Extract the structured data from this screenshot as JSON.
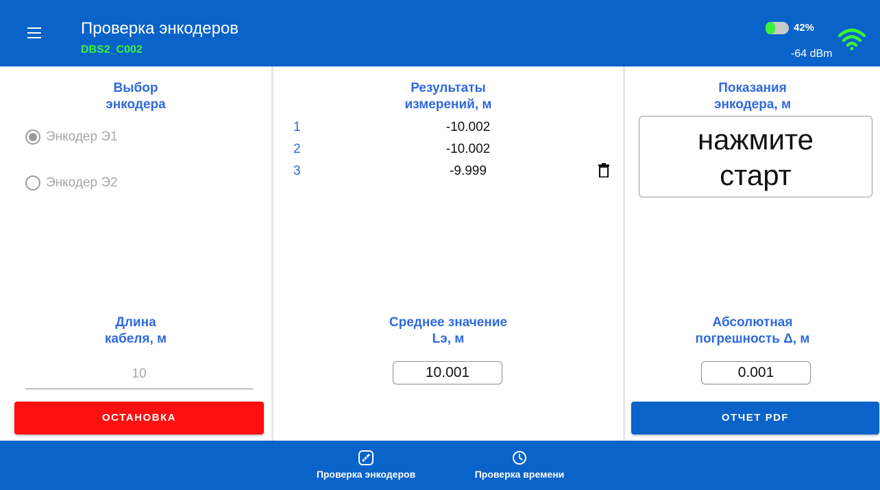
{
  "appbar": {
    "title": "Проверка энкодеров",
    "subtitle": "DBS2_C002",
    "battery_percent": "42%",
    "battery_level": 0.42,
    "signal": "-64 dBm"
  },
  "left": {
    "heading_line1": "Выбор",
    "heading_line2": "энкодера",
    "radios": [
      {
        "label": "Энкодер Э1",
        "checked": true
      },
      {
        "label": "Энкодер Э2",
        "checked": false
      }
    ],
    "cable_heading_line1": "Длина",
    "cable_heading_line2": "кабеля, м",
    "cable_value": "10",
    "stop_label": "ОСТАНОВКА"
  },
  "middle": {
    "heading_line1": "Результаты",
    "heading_line2": "измерений, м",
    "results": [
      {
        "index": "1",
        "value": "-10.002"
      },
      {
        "index": "2",
        "value": "-10.002"
      },
      {
        "index": "3",
        "value": "-9.999"
      }
    ],
    "avg_heading_line1": "Среднее значение",
    "avg_heading_line2": "Lэ, м",
    "avg_value": "10.001"
  },
  "right": {
    "heading_line1": "Показания",
    "heading_line2": "энкодера, м",
    "reading_line1": "нажмите",
    "reading_line2": "старт",
    "abs_heading_line1": "Абсолютная",
    "abs_heading_line2": "погрешность Δ, м",
    "abs_value": "0.001",
    "pdf_label": "ОТЧЕТ PDF"
  },
  "bottom_nav": [
    {
      "label": "Проверка энкодеров",
      "icon": "ruler-icon"
    },
    {
      "label": "Проверка времени",
      "icon": "clock-icon"
    }
  ],
  "colors": {
    "primary": "#0a63c9",
    "accent_green": "#3df03a",
    "heading_blue": "#2f69de",
    "stop_red": "#ff0f0f"
  }
}
